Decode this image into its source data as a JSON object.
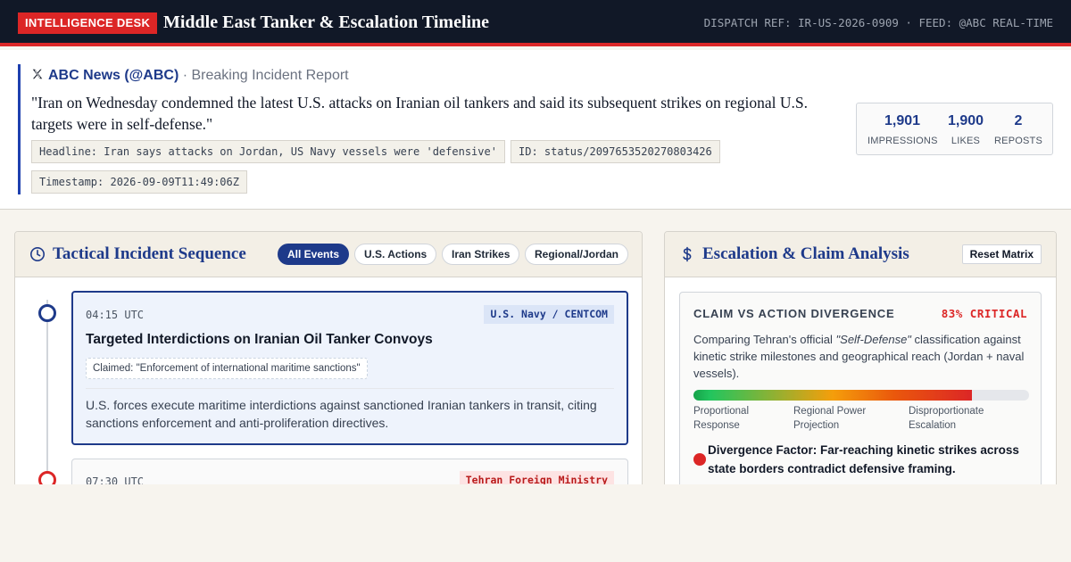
{
  "header": {
    "badge": "INTELLIGENCE DESK",
    "title": "Middle East Tanker & Escalation Timeline",
    "dispatch": "DISPATCH REF: IR-US-2026-0909 · FEED: @ABC REAL-TIME"
  },
  "report": {
    "source_icon": "x-logo-icon",
    "source_name": "ABC News (@ABC)",
    "source_sub": "· Breaking Incident Report",
    "quote": "\"Iran on Wednesday condemned the latest U.S. attacks on Iranian oil tankers and said its subsequent strikes on regional U.S. targets were in self-defense.\"",
    "chips": {
      "headline": "Headline: Iran says attacks on Jordan, US Navy vessels were 'defensive'",
      "id": "ID: status/2097653520270803426",
      "timestamp": "Timestamp: 2026-09-09T11:49:06Z"
    },
    "stats": {
      "impressions": {
        "value": "1,901",
        "label": "IMPRESSIONS"
      },
      "likes": {
        "value": "1,900",
        "label": "LIKES"
      },
      "reposts": {
        "value": "2",
        "label": "REPOSTS"
      }
    }
  },
  "timeline": {
    "icon": "clock-icon",
    "title": "Tactical Incident Sequence",
    "filters": {
      "all": "All Events",
      "us": "U.S. Actions",
      "iran": "Iran Strikes",
      "regional": "Regional/Jordan"
    },
    "events": [
      {
        "time": "04:15 UTC",
        "source": "U.S. Navy / CENTCOM",
        "title": "Targeted Interdictions on Iranian Oil Tanker Convoys",
        "claim": "Claimed: \"Enforcement of international maritime sanctions\"",
        "description": "U.S. forces execute maritime interdictions against sanctioned Iranian tankers in transit, citing sanctions enforcement and anti-proliferation directives."
      },
      {
        "time": "07:30 UTC",
        "source": "Tehran Foreign Ministry"
      }
    ]
  },
  "analysis": {
    "icon": "dollar-icon",
    "title": "Escalation & Claim Analysis",
    "reset_label": "Reset Matrix",
    "matrix": {
      "heading": "CLAIM VS ACTION DIVERGENCE",
      "critical": "83% CRITICAL",
      "divergence_fraction": 0.83,
      "desc_before": "Comparing Tehran's official ",
      "desc_em": "\"Self-Defense\"",
      "desc_after": " classification against kinetic strike milestones and geographical reach (Jordan + naval vessels).",
      "scale": {
        "low": "Proportional Response",
        "mid": "Regional Power Projection",
        "high": "Disproportionate Escalation"
      },
      "factor": "Divergence Factor: Far-reaching kinetic strikes across state borders contradict defensive framing."
    }
  },
  "colors": {
    "navy": "#1e3a8a",
    "alert_red": "#dc2626",
    "header_bg": "#111827"
  }
}
